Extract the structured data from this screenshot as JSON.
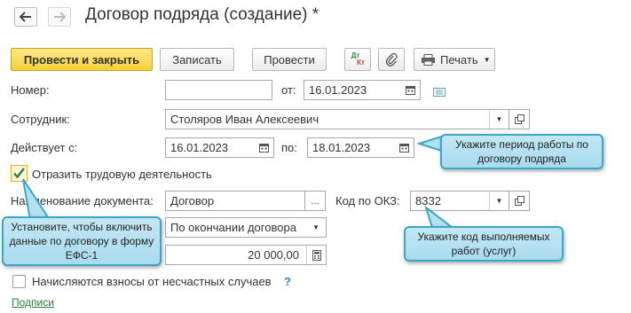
{
  "window": {
    "title": "Договор подряда (создание) *"
  },
  "toolbar": {
    "post_and_close": "Провести и закрыть",
    "save": "Записать",
    "post": "Провести",
    "dt_kt_top": "Дт",
    "dt_kt_bottom": "Кт",
    "print": "Печать"
  },
  "form": {
    "number_label": "Номер:",
    "number_value": "",
    "from_label": "от:",
    "date_value": "16.01.2023",
    "employee_label": "Сотрудник:",
    "employee_value": "Столяров Иван Алексеевич",
    "valid_label": "Действует с:",
    "valid_from": "16.01.2023",
    "valid_to_label": "по:",
    "valid_to": "18.01.2023",
    "reflect_checkbox_label": "Отразить трудовую деятельность",
    "reflect_checked": true,
    "doc_name_label": "Наименование документа:",
    "doc_name_value": "Договор",
    "okz_label": "Код по ОКЗ:",
    "okz_value": "8332",
    "payment_value": "По окончании договора",
    "amount_value": "20 000,00",
    "accident_checkbox_label": "Начисляются взносы от несчастных случаев",
    "accident_checked": false,
    "help": "?",
    "signatures_link": "Подписи"
  },
  "callouts": {
    "period": "Укажите период работы по договору подряда",
    "checkbox": "Установите, чтобы включить данные по договору в форму ЕФС-1",
    "okz": "Укажите код выполняемых работ (услуг)"
  },
  "colors": {
    "primary_button": "#f5d13a",
    "callout_fill": "#b5e0f0",
    "callout_border": "#3aa6c8",
    "link": "#2c7a3d"
  }
}
